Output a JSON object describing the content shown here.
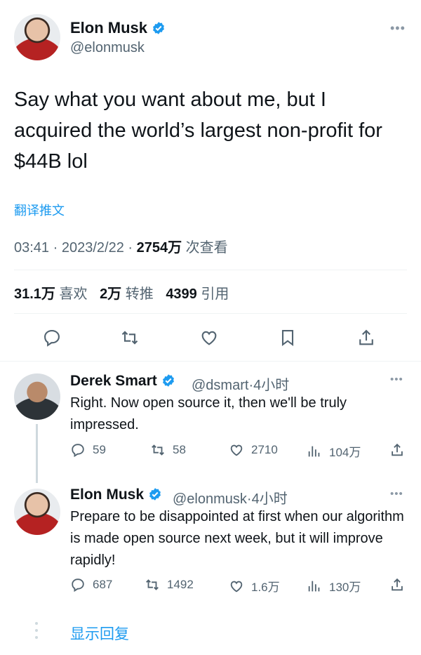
{
  "tweet": {
    "author_name": "Elon Musk",
    "author_handle": "@elonmusk",
    "text": "Say what you want about me, but I acquired the world’s largest non-profit for $44B lol",
    "translate_label": "翻译推文",
    "time": "03:41",
    "date": "2023/2/22",
    "views_count": "2754万",
    "views_label": "次查看",
    "likes_count": "31.1万",
    "likes_label": "喜欢",
    "retweets_count": "2万",
    "retweets_label": "转推",
    "quotes_count": "4399",
    "quotes_label": "引用",
    "more_glyph": "•••"
  },
  "actions": [
    "reply-icon",
    "retweet-icon",
    "like-icon",
    "bookmark-icon",
    "share-icon"
  ],
  "replies": [
    {
      "name": "Derek Smart",
      "handle": "@dsmart",
      "time_ago": "4小时",
      "text": "Right. Now open source it, then we'll be truly impressed.",
      "reply_count": "59",
      "retweet_count": "58",
      "like_count": "2710",
      "view_count": "104万"
    },
    {
      "name": "Elon Musk",
      "handle": "@elonmusk",
      "time_ago": "4小时",
      "text": "Prepare to be disappointed at first when our algorithm is made open source next week, but it will improve rapidly!",
      "reply_count": "687",
      "retweet_count": "1492",
      "like_count": "1.6万",
      "view_count": "130万"
    }
  ],
  "show_replies_label": "显示回复",
  "colors": {
    "accent": "#1d9bf0",
    "secondary_text": "#536471",
    "primary_text": "#0f1419",
    "divider": "#eff3f4"
  }
}
